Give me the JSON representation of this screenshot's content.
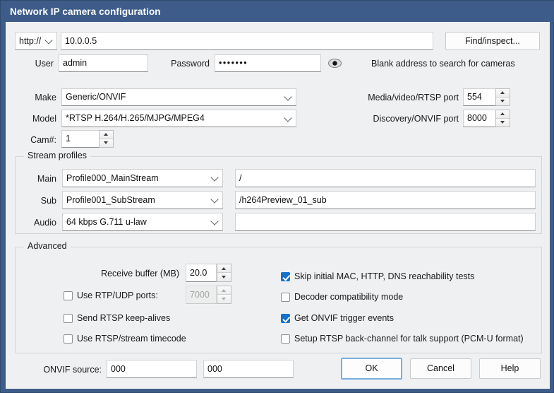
{
  "window": {
    "title": "Network IP camera configuration",
    "titlebar_color": "#3d5c8a",
    "accent_color": "#1272cc",
    "client_bg": "#eff0f1"
  },
  "connection": {
    "protocol_label": "http://",
    "address_value": "10.0.0.5",
    "find_button": "Find/inspect...",
    "user_label": "User",
    "user_value": "admin",
    "password_label": "Password",
    "password_value": "•••••••",
    "reveal_icon": "eye-icon",
    "hint": "Blank address to search for cameras"
  },
  "device": {
    "make_label": "Make",
    "make_value": "Generic/ONVIF",
    "model_label": "Model",
    "model_value": "*RTSP H.264/H.265/MJPG/MPEG4",
    "cam_label": "Cam#:",
    "cam_value": "1",
    "media_port_label": "Media/video/RTSP port",
    "media_port_value": "554",
    "discovery_port_label": "Discovery/ONVIF port",
    "discovery_port_value": "8000"
  },
  "stream_profiles": {
    "title": "Stream profiles",
    "rows": [
      {
        "label": "Main",
        "profile": "Profile000_MainStream",
        "path": "/"
      },
      {
        "label": "Sub",
        "profile": "Profile001_SubStream",
        "path": "/h264Preview_01_sub"
      },
      {
        "label": "Audio",
        "profile": "64 kbps G.711 u-law",
        "path": ""
      }
    ]
  },
  "advanced": {
    "title": "Advanced",
    "receive_buffer_label": "Receive buffer (MB)",
    "receive_buffer_value": "20.0",
    "rtp_udp_label": "Use RTP/UDP ports:",
    "rtp_udp_checked": false,
    "rtp_udp_port_value": "7000",
    "rtp_udp_port_disabled": true,
    "keepalives_label": "Send RTSP keep-alives",
    "keepalives_checked": false,
    "timecode_label": "Use RTSP/stream timecode",
    "timecode_checked": false,
    "skip_initial_label": "Skip initial MAC, HTTP, DNS reachability tests",
    "skip_initial_checked": true,
    "decoder_compat_label": "Decoder compatibility mode",
    "decoder_compat_checked": false,
    "onvif_trigger_label": "Get ONVIF trigger events",
    "onvif_trigger_checked": true,
    "back_channel_label": "Setup RTSP back-channel for talk support (PCM-U format)",
    "back_channel_checked": false
  },
  "footer": {
    "onvif_source_label": "ONVIF source:",
    "onvif_source_value_1": "000",
    "onvif_source_value_2": "000",
    "ok_label": "OK",
    "cancel_label": "Cancel",
    "help_label": "Help"
  }
}
